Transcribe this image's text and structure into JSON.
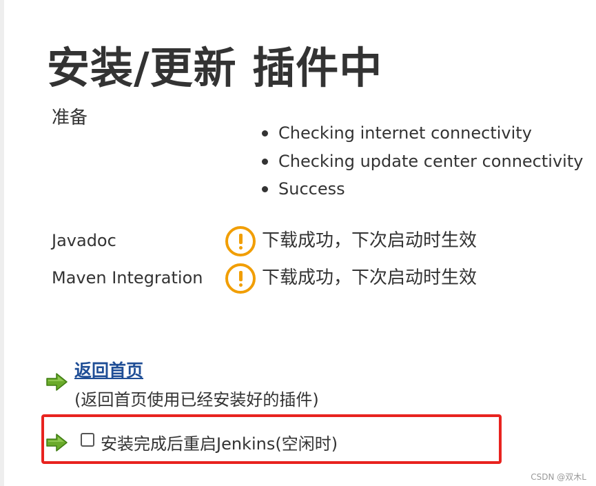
{
  "page_title": "安装/更新 插件中",
  "preparation": {
    "label": "准备",
    "checks": [
      "Checking internet connectivity",
      "Checking update center connectivity",
      "Success"
    ]
  },
  "plugins": [
    {
      "name": "Javadoc",
      "status": "下载成功，下次启动时生效",
      "icon": "warning-icon"
    },
    {
      "name": "Maven Integration",
      "status": "下载成功，下次启动时生效",
      "icon": "warning-icon"
    }
  ],
  "actions": {
    "go_home": {
      "link_text": "返回首页",
      "description": "(返回首页使用已经安装好的插件)",
      "icon": "green-arrow-icon"
    },
    "restart": {
      "label": "安装完成后重启Jenkins(空闲时)",
      "checked": false,
      "icon": "green-arrow-icon"
    }
  },
  "watermark": "CSDN @双木L",
  "colors": {
    "warning": "#f19e03",
    "link": "#1f4e96",
    "highlight_box": "#e8231f",
    "arrow": "#6aaa2a"
  }
}
